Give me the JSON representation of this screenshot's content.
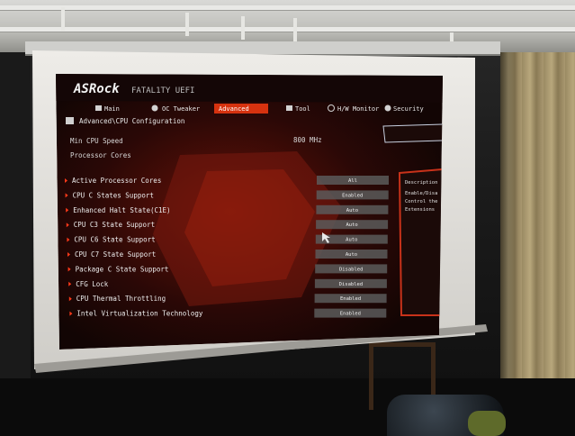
{
  "brand": {
    "logo_text": "ASRock",
    "sub_logo_text": "FATAL1TY UEFI"
  },
  "tabs": [
    {
      "label": "Main"
    },
    {
      "label": "OC Tweaker"
    },
    {
      "label": "Advanced",
      "active": true
    },
    {
      "label": "Tool"
    },
    {
      "label": "H/W Monitor"
    },
    {
      "label": "Security"
    }
  ],
  "breadcrumb": "Advanced\\CPU Configuration",
  "info_rows": [
    {
      "label": "Min CPU Speed",
      "value": "800 MHz"
    },
    {
      "label": "Processor Cores",
      "value": ""
    }
  ],
  "settings": [
    {
      "label": "Active Processor Cores",
      "value": "All"
    },
    {
      "label": "CPU C States Support",
      "value": "Enabled"
    },
    {
      "label": "Enhanced Halt State(C1E)",
      "value": "Auto"
    },
    {
      "label": "CPU C3 State Support",
      "value": "Auto"
    },
    {
      "label": "CPU C6 State Support",
      "value": "Auto"
    },
    {
      "label": "CPU C7 State Support",
      "value": "Auto"
    },
    {
      "label": "Package C State Support",
      "value": "Disabled"
    },
    {
      "label": "CFG Lock",
      "value": "Disabled"
    },
    {
      "label": "CPU Thermal Throttling",
      "value": "Enabled"
    },
    {
      "label": "Intel Virtualization Technology",
      "value": "Enabled"
    }
  ],
  "description": {
    "title": "Description",
    "lines": [
      "Enable/Disa",
      "Control the",
      "Extensions"
    ]
  },
  "colors": {
    "accent": "#ff2a10",
    "panel": "#1a0a08",
    "screen_white": "#e8e6e2"
  },
  "icons": {
    "tab_icons": [
      "home-icon",
      "gauge-icon",
      "star-icon",
      "tool-icon",
      "monitor-icon",
      "shield-icon"
    ]
  }
}
